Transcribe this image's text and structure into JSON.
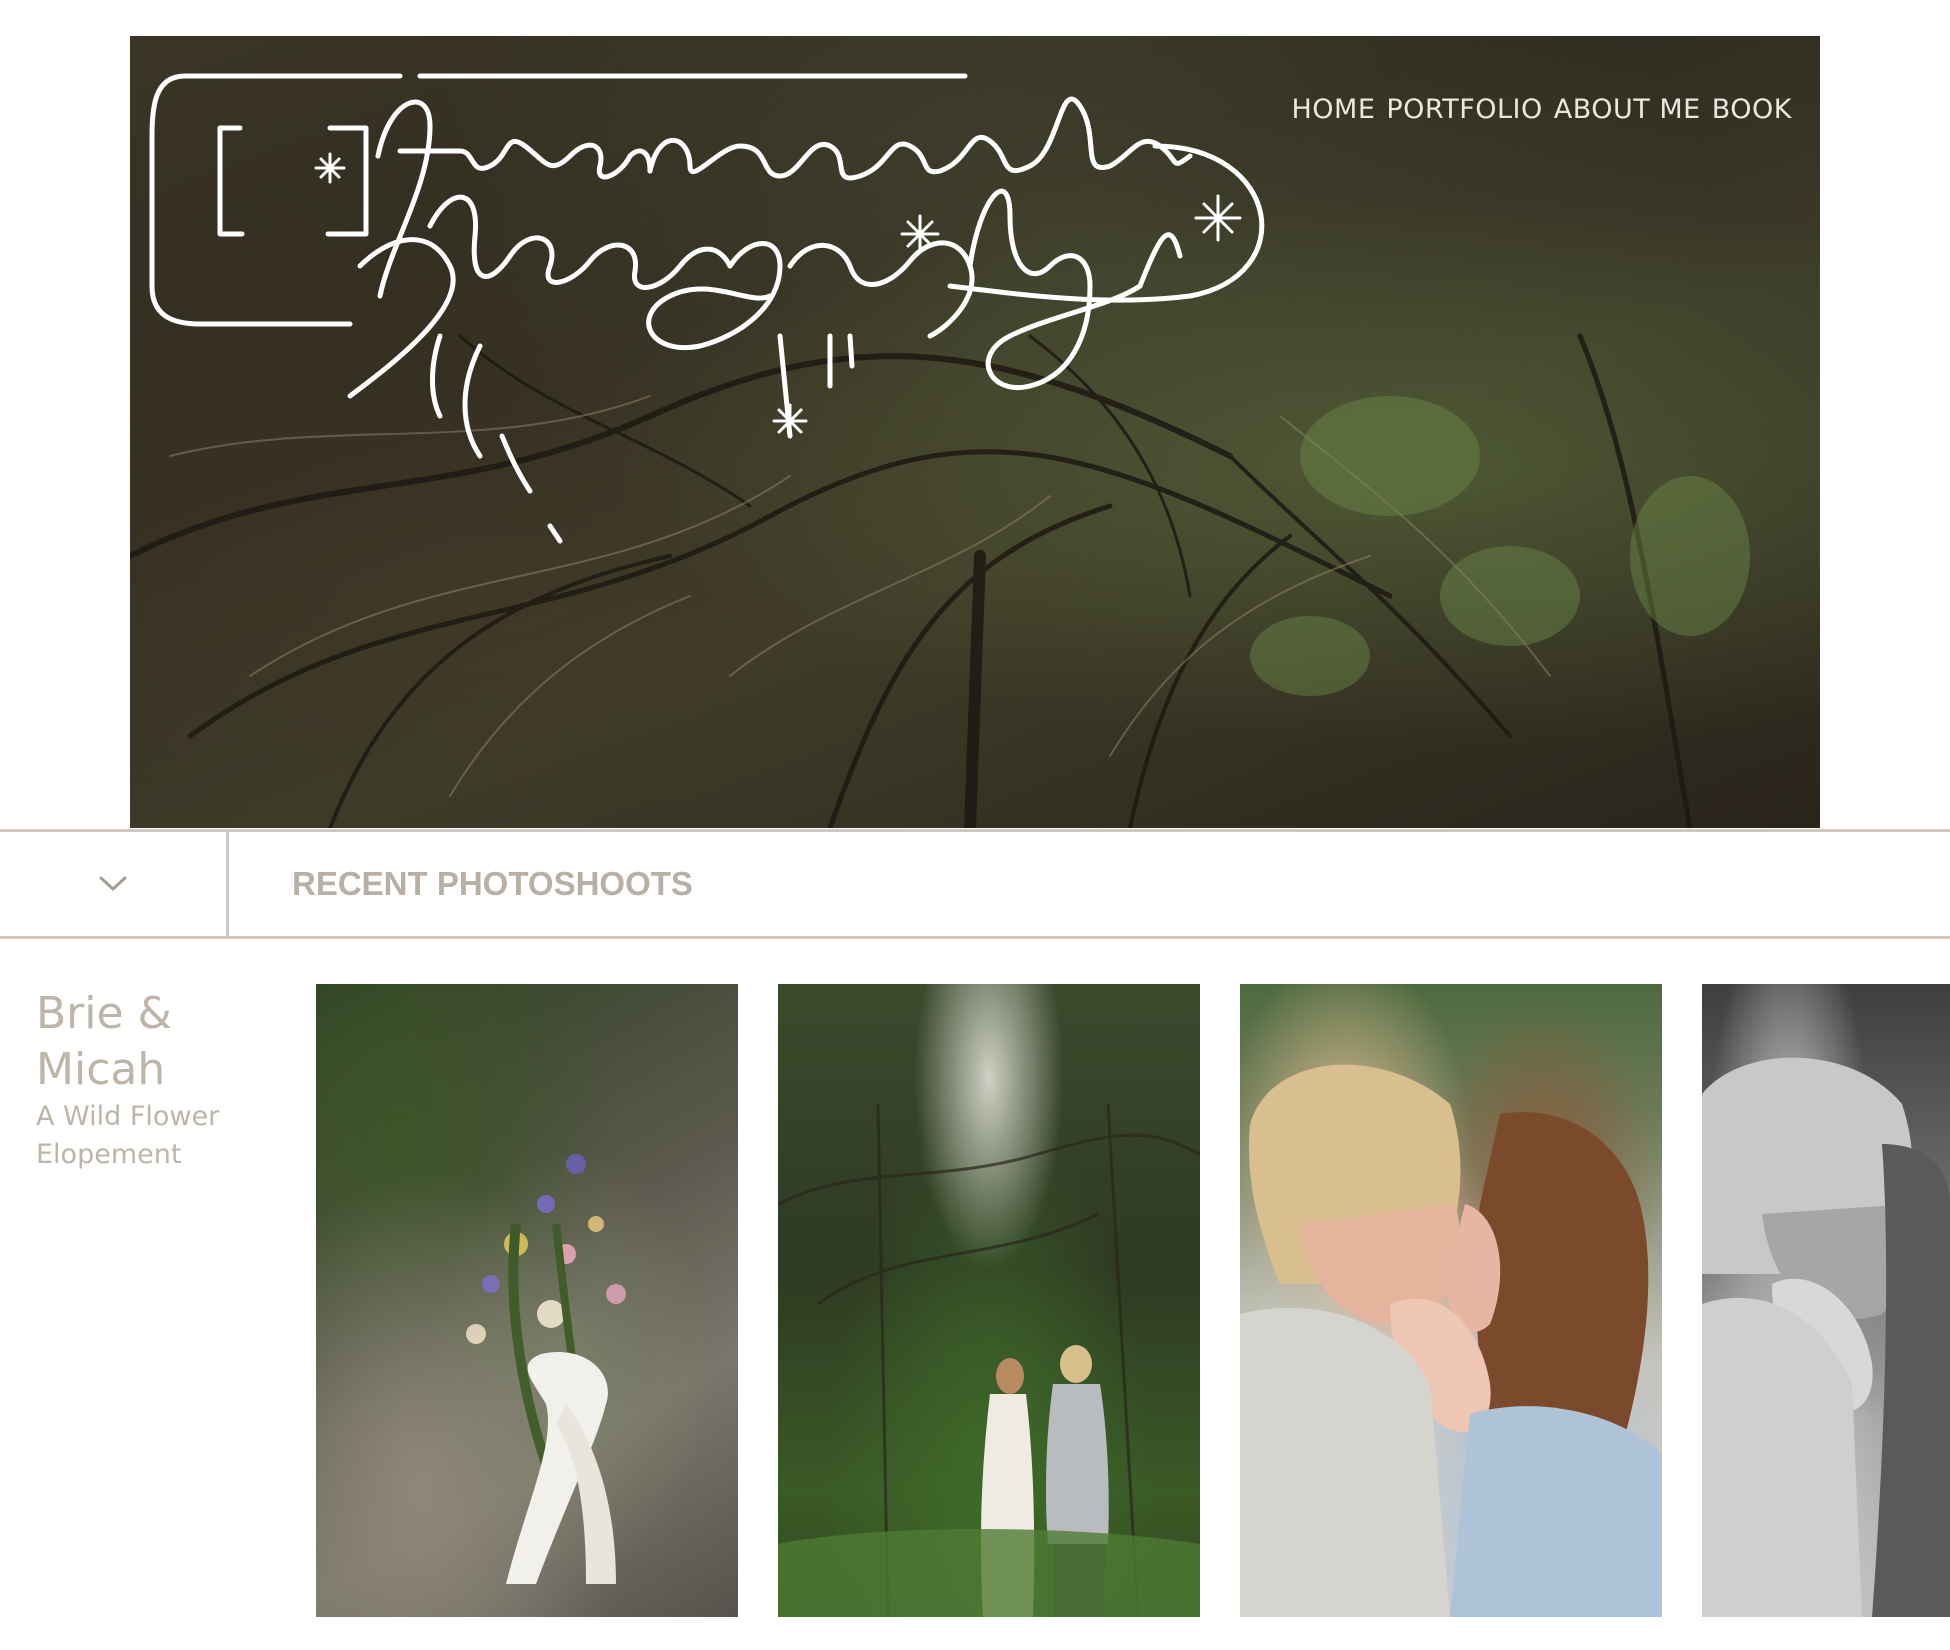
{
  "site": {
    "logo_text": "from november photography",
    "nav": [
      "HOME",
      "PORTFOLIO",
      "ABOUT ME",
      "BOOK"
    ]
  },
  "section": {
    "title": "RECENT PHOTOSHOOTS",
    "toggle_icon": "chevron-down-icon"
  },
  "shoot": {
    "title": "Brie & Micah",
    "subtitle": "A Wild Flower Elopement"
  },
  "gallery": {
    "photos": [
      {
        "subject": "wildflower bouquet on rock"
      },
      {
        "subject": "couple in forest"
      },
      {
        "subject": "couple kissing"
      },
      {
        "subject": "couple kissing black and white"
      }
    ]
  },
  "colors": {
    "muted_text": "#b5aca2",
    "divider": "#cfc8c0",
    "nav_text": "#ece7de"
  }
}
